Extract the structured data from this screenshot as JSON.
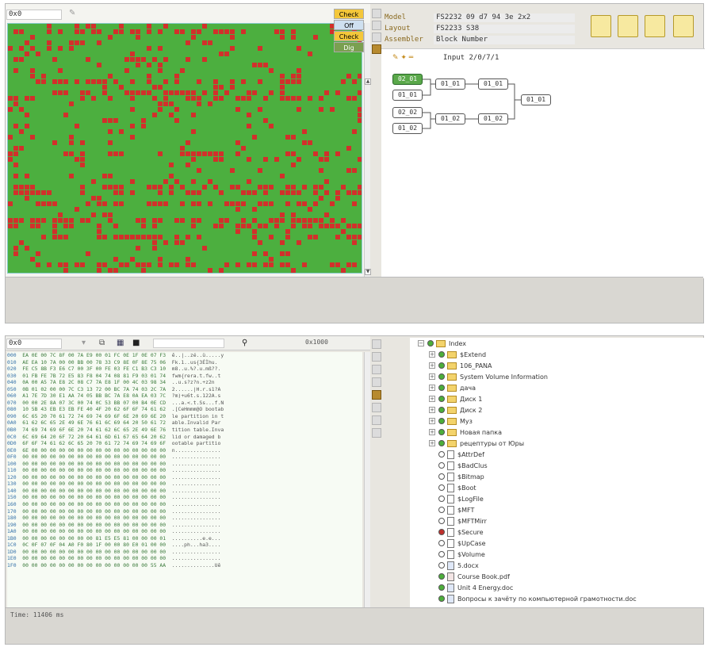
{
  "top": {
    "address": "0x0",
    "dropdown": [
      "Check",
      "Off",
      "Check",
      "Dig"
    ],
    "info": [
      {
        "label": "Model",
        "value": "FS2232  09 d7 94 3e  2x2"
      },
      {
        "label": "Layout",
        "value": "FS2233 S38"
      },
      {
        "label": "Assembler",
        "value": "Block Number"
      }
    ],
    "diagram_title": "Input 2/0/7/1",
    "nodes": [
      "02_01",
      "01_01",
      "01_01",
      "01_01",
      "01_01",
      "02_02",
      "01_02",
      "01_02",
      "01_02"
    ]
  },
  "bottom": {
    "address": "0x0",
    "search": "0x1000",
    "time": "Time: 11406 ms",
    "hex_rows": [
      {
        "o": "000",
        "b": "EA 0E 00 7C 8F 00 7A E9 00 01 FC 0E 1F 0E 07 F3",
        "a": "ê..|..zé..ü.....y"
      },
      {
        "o": "010",
        "b": "AE EA 10 7A 00 00 BB 00 78 33 C9 8E 0F 8E 75 06",
        "a": "Fk.1..us{3ÉÌhu."
      },
      {
        "o": "020",
        "b": "FE C5 8B F3 E6 C7 00 3F 00 FE 03 FE C1 B3 C3 10",
        "a": "m8..u.%?.u.mß??."
      },
      {
        "o": "030",
        "b": "01 FB FE 7B 72 E5 83 F8 04 74 08 81 F9 03 01 74",
        "a": "fwm{rera.t.fw..t"
      },
      {
        "o": "040",
        "b": "0A 00 A5 7A E8 2C 08 C7 7A E8 1F 00 4C 03 98 34",
        "a": "..u.s?z?n.+z2n"
      },
      {
        "o": "050",
        "b": "0B 01 02 00 00 7C C3 13 72 00 BC 7A 74 03 2C 7A",
        "a": "2......|H.r.s1?A"
      },
      {
        "o": "060",
        "b": "A1 7E 7D 30 E1 AA 74 05 BB BC 7A E8 0A EA 03 7C",
        "a": "?m)+u6t.s.122A.s"
      },
      {
        "o": "070",
        "b": "00 00 2E 8A 07 3C 00 74 0C 53 BB 07 00 B4 0E CD",
        "a": "...a.<.t.Ss...f.N"
      },
      {
        "o": "080",
        "b": "10 5B 43 EB E3 EB FE 40 4F 20 62 6F 6F 74 61 62",
        "a": ".[CeHmmm@O bootab"
      },
      {
        "o": "090",
        "b": "6C 65 20 70 61 72 74 69 74 69 6F 6E 20 69 6E 20",
        "a": "le partition in t"
      },
      {
        "o": "0A0",
        "b": "61 62 6C 65 2E 49 6E 76 61 6C 69 64 20 50 61 72",
        "a": "able.Invalid Par"
      },
      {
        "o": "0B0",
        "b": "74 69 74 69 6F 6E 20 74 61 62 6C 65 2E 49 6E 76",
        "a": "tition table.Inva"
      },
      {
        "o": "0C0",
        "b": "6C 69 64 20 6F 72 20 64 61 6D 61 67 65 64 20 62",
        "a": "lid or damaged b"
      },
      {
        "o": "0D0",
        "b": "6F 6F 74 61 62 6C 65 20 70 61 72 74 69 74 69 6F",
        "a": "ootable partitio"
      },
      {
        "o": "0E0",
        "b": "6E 00 00 00 00 00 00 00 00 00 00 00 00 00 00 00",
        "a": "n..............."
      },
      {
        "o": "0F0",
        "b": "00 00 00 00 00 00 00 00 00 00 00 00 00 00 00 00",
        "a": "................"
      },
      {
        "o": "100",
        "b": "00 00 00 00 00 00 00 00 00 00 00 00 00 00 00 00",
        "a": "................"
      },
      {
        "o": "110",
        "b": "00 00 00 00 00 00 00 00 00 00 00 00 00 00 00 00",
        "a": "................"
      },
      {
        "o": "120",
        "b": "00 00 00 00 00 00 00 00 00 00 00 00 00 00 00 00",
        "a": "................"
      },
      {
        "o": "130",
        "b": "00 00 00 00 00 00 00 00 00 00 00 00 00 00 00 00",
        "a": "................"
      },
      {
        "o": "140",
        "b": "00 00 00 00 00 00 00 00 00 00 00 00 00 00 00 00",
        "a": "................"
      },
      {
        "o": "150",
        "b": "00 00 00 00 00 00 00 00 00 00 00 00 00 00 00 00",
        "a": "................"
      },
      {
        "o": "160",
        "b": "00 00 00 00 00 00 00 00 00 00 00 00 00 00 00 00",
        "a": "................"
      },
      {
        "o": "170",
        "b": "00 00 00 00 00 00 00 00 00 00 00 00 00 00 00 00",
        "a": "................"
      },
      {
        "o": "180",
        "b": "00 00 00 00 00 00 00 00 00 00 00 00 00 00 00 00",
        "a": "................"
      },
      {
        "o": "190",
        "b": "00 00 00 00 00 00 00 00 00 00 00 00 00 00 00 00",
        "a": "................"
      },
      {
        "o": "1A0",
        "b": "00 00 00 00 00 00 00 00 00 00 00 00 00 00 00 00",
        "a": "................"
      },
      {
        "o": "1B0",
        "b": "00 00 00 00 00 00 00 00 81 E5 E5 81 00 00 00 01",
        "a": "..........e.e..."
      },
      {
        "o": "1C0",
        "b": "0C 0F 07 0F 04 A0 F0 80 1F 00 00 80 E0 01 00 00",
        "a": "....ph...ha3...."
      },
      {
        "o": "1D0",
        "b": "00 00 00 00 00 00 00 00 00 00 00 00 00 00 00 00",
        "a": "................"
      },
      {
        "o": "1E0",
        "b": "00 00 00 00 00 00 00 00 00 00 00 00 00 00 00 00",
        "a": "................"
      },
      {
        "o": "1F0",
        "b": "00 00 00 00 00 00 00 00 00 00 00 00 00 00 55 AA",
        "a": "..............Uê"
      }
    ],
    "tree": [
      {
        "label": "Index",
        "indent": 0,
        "kind": "folder",
        "dot": "g",
        "exp": "−"
      },
      {
        "label": "$Extend",
        "indent": 1,
        "kind": "folder",
        "dot": "g",
        "exp": "+"
      },
      {
        "label": "106_PANA",
        "indent": 1,
        "kind": "folder",
        "dot": "g",
        "exp": "+"
      },
      {
        "label": "System Volume Information",
        "indent": 1,
        "kind": "folder",
        "dot": "g",
        "exp": "+"
      },
      {
        "label": "дача",
        "indent": 1,
        "kind": "folder",
        "dot": "g",
        "exp": "+"
      },
      {
        "label": "Диск 1",
        "indent": 1,
        "kind": "folder",
        "dot": "g",
        "exp": "+"
      },
      {
        "label": "Диск 2",
        "indent": 1,
        "kind": "folder",
        "dot": "g",
        "exp": "+"
      },
      {
        "label": "Муз",
        "indent": 1,
        "kind": "folder",
        "dot": "g",
        "exp": "+"
      },
      {
        "label": "Новая папка",
        "indent": 1,
        "kind": "folder",
        "dot": "g",
        "exp": "+"
      },
      {
        "label": "рецептуры от Юры",
        "indent": 1,
        "kind": "folder",
        "dot": "g",
        "exp": "+"
      },
      {
        "label": "$AttrDef",
        "indent": 1,
        "kind": "file",
        "dot": "o",
        "exp": ""
      },
      {
        "label": "$BadClus",
        "indent": 1,
        "kind": "file",
        "dot": "o",
        "exp": ""
      },
      {
        "label": "$Bitmap",
        "indent": 1,
        "kind": "file",
        "dot": "o",
        "exp": ""
      },
      {
        "label": "$Boot",
        "indent": 1,
        "kind": "file",
        "dot": "o",
        "exp": ""
      },
      {
        "label": "$LogFile",
        "indent": 1,
        "kind": "file",
        "dot": "o",
        "exp": ""
      },
      {
        "label": "$MFT",
        "indent": 1,
        "kind": "file",
        "dot": "o",
        "exp": ""
      },
      {
        "label": "$MFTMirr",
        "indent": 1,
        "kind": "file",
        "dot": "o",
        "exp": ""
      },
      {
        "label": "$Secure",
        "indent": 1,
        "kind": "file",
        "dot": "r",
        "exp": ""
      },
      {
        "label": "$UpCase",
        "indent": 1,
        "kind": "file",
        "dot": "o",
        "exp": ""
      },
      {
        "label": "$Volume",
        "indent": 1,
        "kind": "file",
        "dot": "o",
        "exp": ""
      },
      {
        "label": "5.docx",
        "indent": 1,
        "kind": "doc",
        "dot": "o",
        "exp": ""
      },
      {
        "label": "Course Book.pdf",
        "indent": 1,
        "kind": "pdf",
        "dot": "g",
        "exp": ""
      },
      {
        "label": "Unit 4 Energy.doc",
        "indent": 1,
        "kind": "doc",
        "dot": "g",
        "exp": ""
      },
      {
        "label": "Вопросы к зачёту по компьютерной грамотности.doc",
        "indent": 1,
        "kind": "doc",
        "dot": "g",
        "exp": ""
      }
    ]
  },
  "colors": {
    "good": "#4caf3f",
    "bad": "#d2302b",
    "grid": "#d8f0d0",
    "accent": "#b78a2e"
  }
}
